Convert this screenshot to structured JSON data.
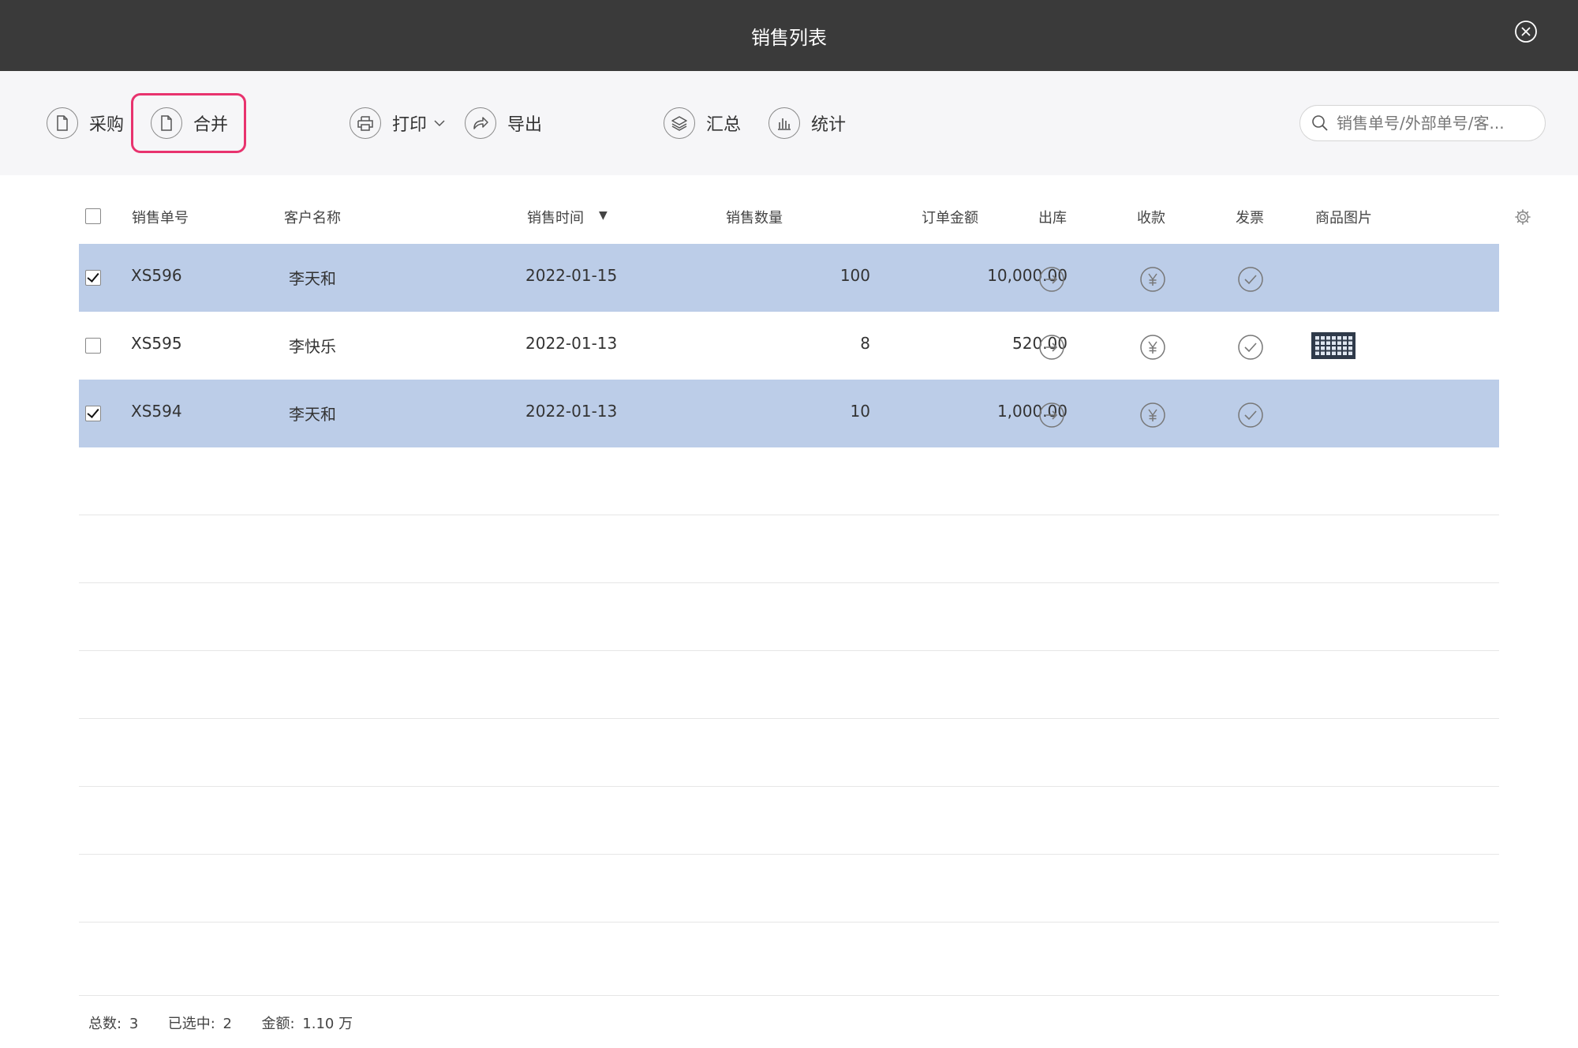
{
  "window": {
    "title": "销售列表"
  },
  "toolbar": {
    "purchase_label": "采购",
    "merge_label": "合并",
    "print_label": "打印",
    "export_label": "导出",
    "summary_label": "汇总",
    "stats_label": "统计",
    "search_placeholder": "销售单号/外部单号/客..."
  },
  "table": {
    "columns": {
      "order_no": "销售单号",
      "customer": "客户名称",
      "time": "销售时间",
      "sort_indicator": "▼",
      "quantity": "销售数量",
      "amount": "订单金额",
      "outbound": "出库",
      "payment": "收款",
      "invoice": "发票",
      "image": "商品图片"
    },
    "rows": [
      {
        "checked": true,
        "order_no": "XS596",
        "customer": "李天和",
        "time": "2022-01-15",
        "quantity": "100",
        "amount": "10,000.00",
        "has_image": false
      },
      {
        "checked": false,
        "order_no": "XS595",
        "customer": "李快乐",
        "time": "2022-01-13",
        "quantity": "8",
        "amount": "520.00",
        "has_image": true
      },
      {
        "checked": true,
        "order_no": "XS594",
        "customer": "李天和",
        "time": "2022-01-13",
        "quantity": "10",
        "amount": "1,000.00",
        "has_image": false
      }
    ]
  },
  "footer": {
    "total_label": "总数:",
    "total_value": "3",
    "selected_label": "已选中:",
    "selected_value": "2",
    "amount_label": "金额:",
    "amount_value": "1.10 万"
  },
  "colors": {
    "titlebar": "#3a3a3a",
    "toolbar_bg": "#f6f6f8",
    "selected_row": "#bccde8",
    "highlight": "#e8336e"
  }
}
